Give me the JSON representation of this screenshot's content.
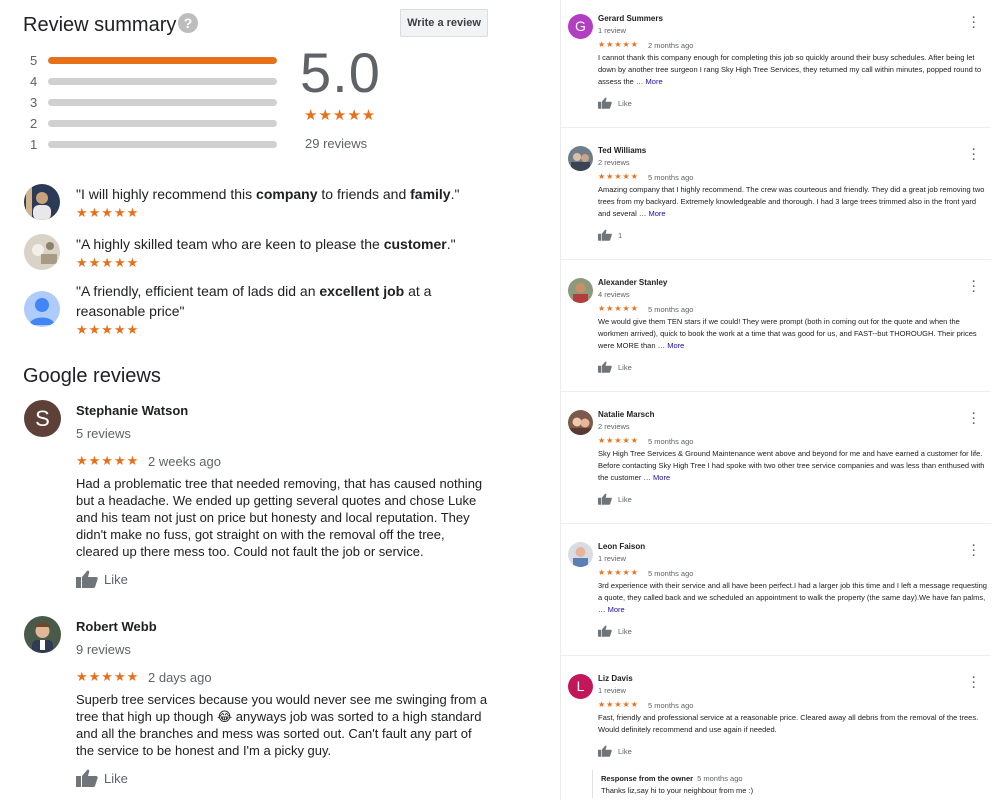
{
  "summary": {
    "title": "Review summary",
    "help_icon": "?",
    "write_review_label": "Write a review",
    "bars": [
      {
        "label": "5",
        "fraction": 1.0
      },
      {
        "label": "4",
        "fraction": 0.0
      },
      {
        "label": "3",
        "fraction": 0.0
      },
      {
        "label": "2",
        "fraction": 0.0
      },
      {
        "label": "1",
        "fraction": 0.0
      }
    ],
    "score": "5.0",
    "stars": "★★★★★",
    "review_count": "29 reviews",
    "accent_color": "#e7711b"
  },
  "snippets": [
    {
      "pre": "\"I will highly recommend this ",
      "b1": "company",
      "mid": " to friends and ",
      "b2": "family",
      "post": ".\"",
      "stars": "★★★★★"
    },
    {
      "pre": "\"A highly skilled team who are keen to please the ",
      "b1": "customer",
      "post": ".\"",
      "stars": "★★★★★"
    },
    {
      "pre": "\"A friendly, efficient team of lads did an ",
      "b1": "excellent job",
      "post": " at a reasonable price\"",
      "stars": "★★★★★"
    }
  ],
  "google_reviews": {
    "title": "Google reviews",
    "items": [
      {
        "avatar_letter": "S",
        "avatar_color": "#5d4037",
        "name": "Stephanie Watson",
        "count": "5 reviews",
        "stars": "★★★★★",
        "date": "2 weeks ago",
        "text": "Had a problematic tree that needed removing, that has caused nothing but a headache. We ended up getting several quotes and chose Luke and his team not just on price but honesty and local reputation. They didn't make no fuss, got straight on with the removal off the tree, cleared up there mess too. Could not fault the job or service.",
        "like": "Like"
      },
      {
        "name": "Robert Webb",
        "count": "9 reviews",
        "stars": "★★★★★",
        "date": "2 days ago",
        "text": "Superb tree services because you would never see me swinging from a tree that high up though 😂 anyways job was sorted to a high standard and all the branches and mess was sorted out. Can't fault any part of the service to be honest and I'm a picky guy.",
        "like": "Like"
      }
    ]
  },
  "right_reviews": [
    {
      "avatar_letter": "G",
      "avatar_color": "#b23fc1",
      "name": "Gerard Summers",
      "count": "1 review",
      "stars": "★★★★★",
      "date": "2 months ago",
      "text": "I cannot thank this company enough for completing this job so quickly around their busy schedules. After being let down by another tree surgeon I rang Sky High Tree Services, they returned my call within minutes, popped round to assess the … ",
      "more": "More",
      "like": "Like"
    },
    {
      "name": "Ted Williams",
      "count": "2 reviews",
      "stars": "★★★★★",
      "date": "5 months ago",
      "text": "Amazing company that I highly recommend. The crew was courteous and friendly. They did a great job removing two trees from my backyard. Extremely knowledgeable and thorough. I had 3 large trees trimmed also in the front yard and several … ",
      "more": "More",
      "like": "1"
    },
    {
      "name": "Alexander Stanley",
      "count": "4 reviews",
      "stars": "★★★★★",
      "date": "5 months ago",
      "text": "We would give them TEN stars if we could! They were prompt (both in coming out for the quote and when the workmen arrived), quick to book the work at a time that was good for us, and FAST--but THOROUGH. Their prices were MORE than … ",
      "more": "More",
      "like": "Like"
    },
    {
      "name": "Natalie Marsch",
      "count": "2 reviews",
      "stars": "★★★★★",
      "date": "5 months ago",
      "text": "Sky High Tree Services & Ground Maintenance went above and beyond for me and have earned a customer for life.  Before contacting Sky High Tree I had spoke with two other tree service companies and was less than enthused with the customer … ",
      "more": "More",
      "like": "Like"
    },
    {
      "name": "Leon Faison",
      "count": "1 review",
      "stars": "★★★★★",
      "date": "5 months ago",
      "text": "3rd experience with their service and all have been perfect.I had a larger job this time and I left a message requesting a quote, they called back and we scheduled an appointment to walk the property (the same day).We have fan palms, … ",
      "more": "More",
      "like": "Like"
    },
    {
      "avatar_letter": "L",
      "avatar_color": "#c2185b",
      "name": "Liz Davis",
      "count": "1 review",
      "stars": "★★★★★",
      "date": "5 months ago",
      "text": "Fast, friendly and professional service at a reasonable price. Cleared away all debris from the removal of the trees. Would definitely recommend and use again if needed.",
      "more": "",
      "like": "Like",
      "owner_response": {
        "label": "Response from the owner",
        "date": "5 months ago",
        "text": "Thanks liz,say hi to your neighbour from me :)"
      }
    }
  ]
}
